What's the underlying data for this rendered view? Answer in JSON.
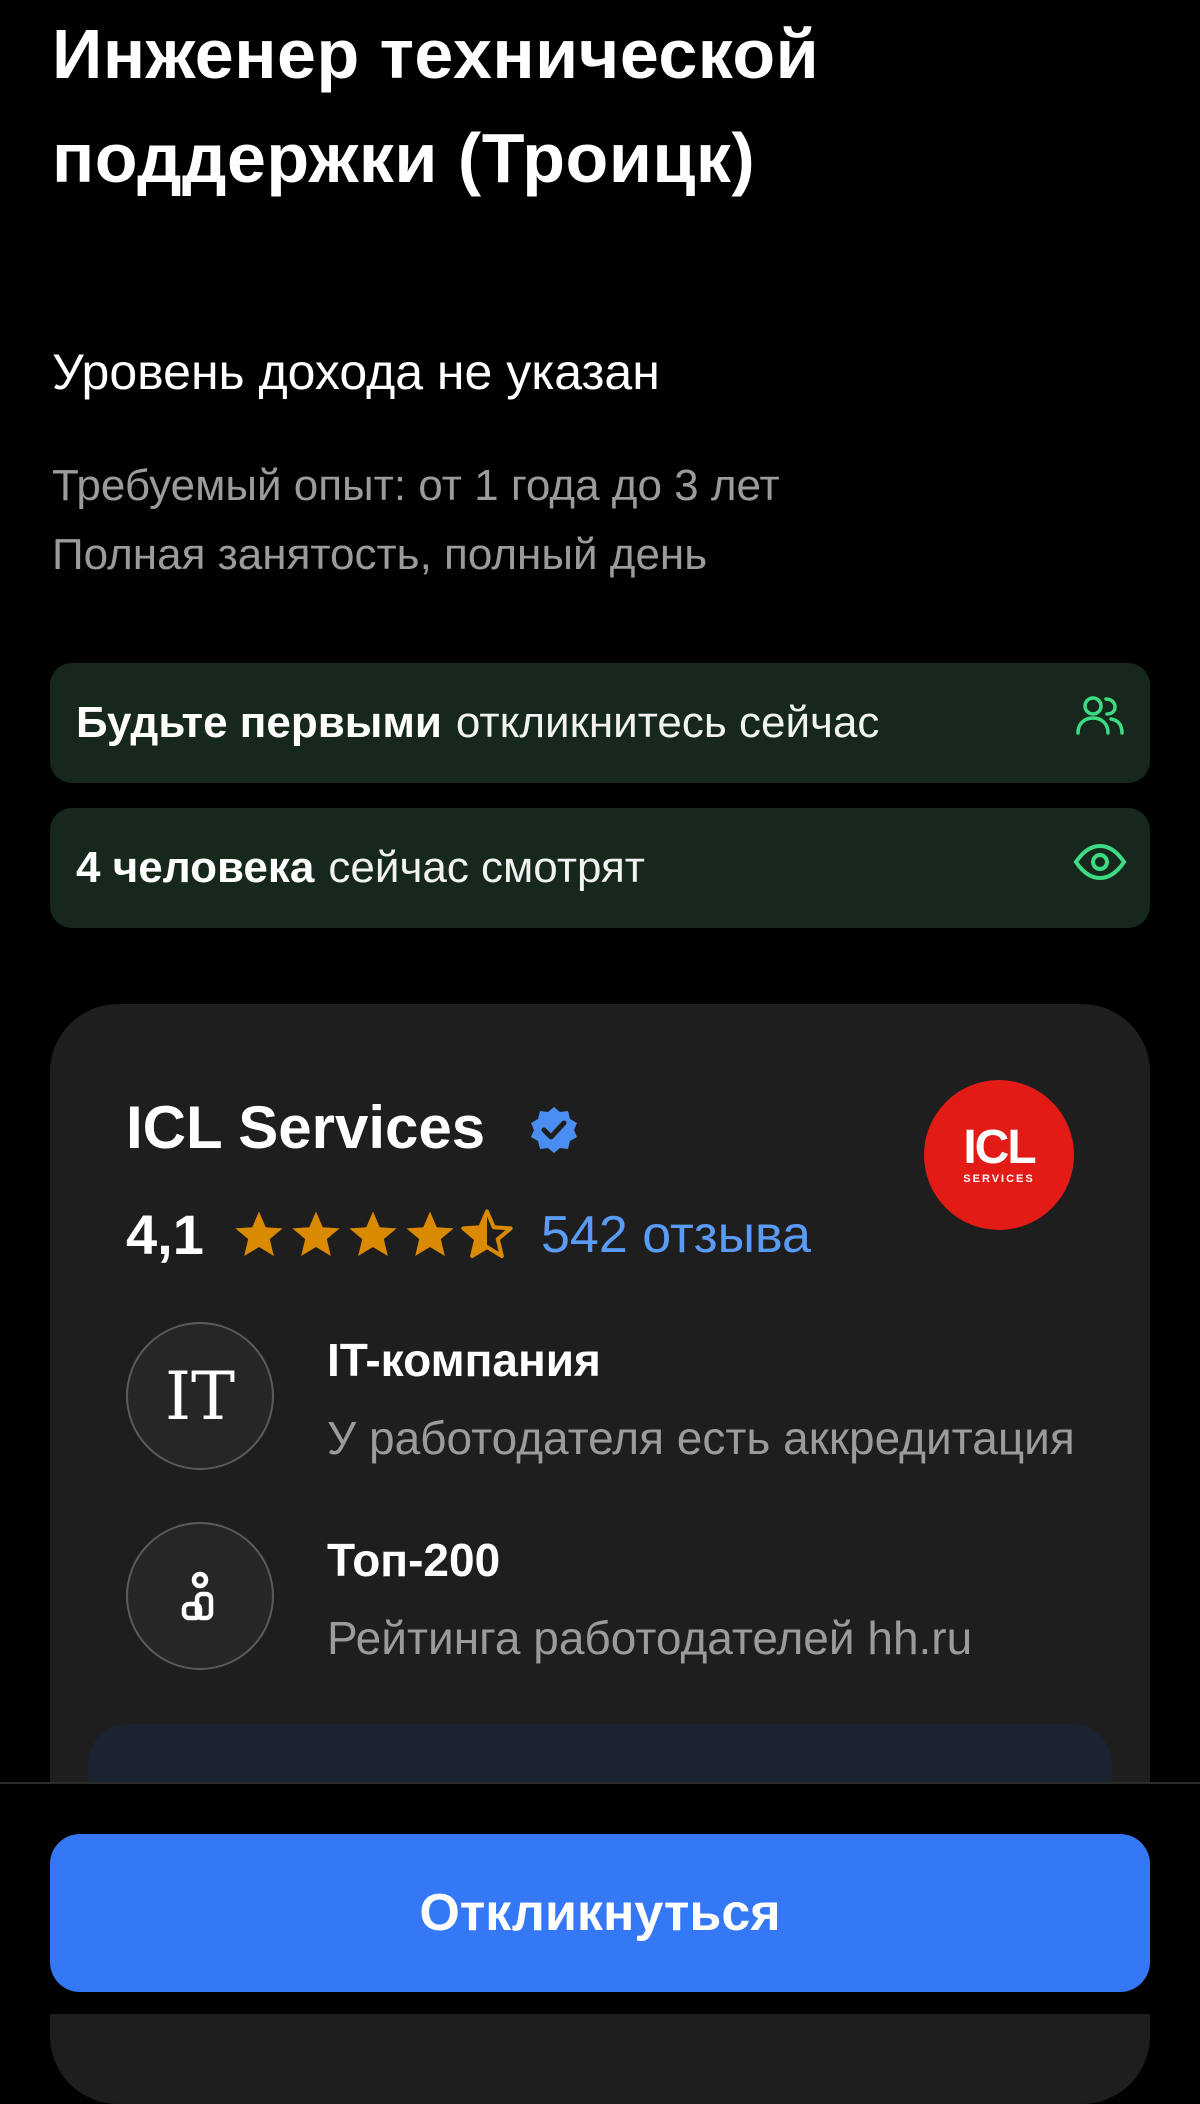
{
  "vacancy": {
    "title": "Инженер технической поддержки (Троицк)",
    "salary": "Уровень дохода не указан",
    "experience": "Требуемый опыт: от 1 года до 3 лет",
    "employment": "Полная занятость, полный день"
  },
  "banners": [
    {
      "bold": "Будьте первыми",
      "rest": "откликнитесь сейчас",
      "icon": "people-icon",
      "color": "#3ddc84"
    },
    {
      "bold": "4 человека",
      "rest": "сейчас смотрят",
      "icon": "eye-icon",
      "color": "#3ddc84"
    }
  ],
  "company": {
    "name": "ICL Services",
    "verified_icon": "verified-badge-icon",
    "logo_text": "ICL",
    "logo_sub": "SERVICES",
    "logo_color": "#e31b17",
    "rating": "4,1",
    "stars": 4.5,
    "star_color": "#d98a00",
    "reviews": "542 отзыва",
    "features": [
      {
        "icon_text": "IT",
        "title": "IT-компания",
        "subtitle": "У работодателя есть аккредитация"
      },
      {
        "icon": "top-rating-icon",
        "title": "Топ-200",
        "subtitle": "Рейтинга работодателей hh.ru"
      }
    ]
  },
  "actions": {
    "apply_label": "Откликнуться",
    "accent": "#3478f6"
  }
}
